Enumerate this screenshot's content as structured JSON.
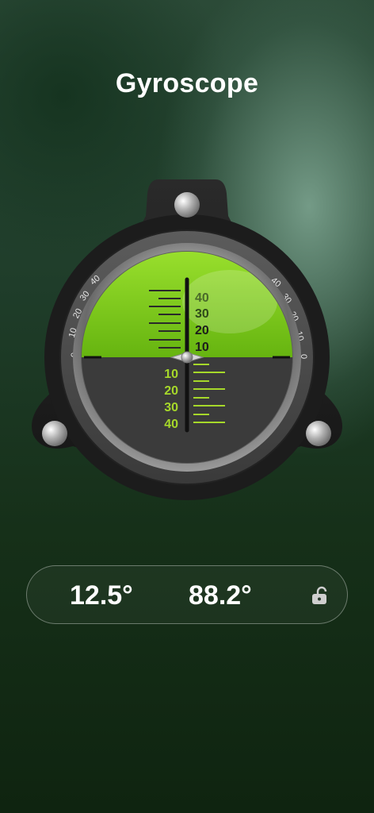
{
  "header": {
    "title": "Gyroscope"
  },
  "gauge": {
    "upper_scale_labels": [
      "40",
      "30",
      "20",
      "10"
    ],
    "lower_scale_labels": [
      "10",
      "20",
      "30",
      "40"
    ],
    "left_arc_labels": [
      "0",
      "10",
      "20",
      "30",
      "40"
    ],
    "right_arc_labels": [
      "40",
      "30",
      "20",
      "10",
      "0"
    ],
    "colors": {
      "green": "#7fd01c",
      "dark": "#3a3a3a",
      "lower_text": "#a6d82a"
    }
  },
  "readout": {
    "value_1": "12.5°",
    "value_2": "88.2°",
    "lock_icon": "unlock-icon"
  }
}
